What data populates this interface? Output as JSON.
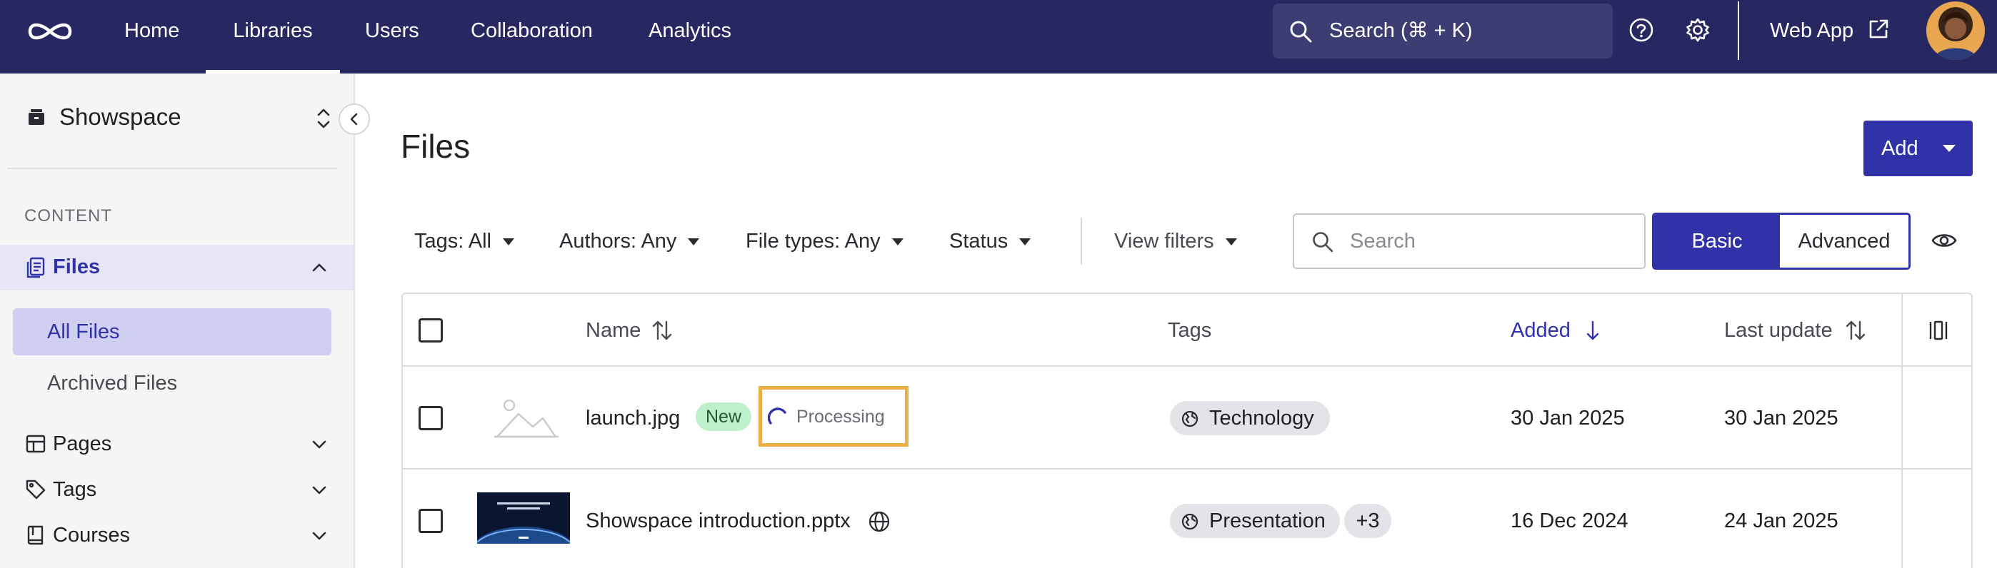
{
  "topbar": {
    "nav": [
      {
        "label": "Home",
        "active": false
      },
      {
        "label": "Libraries",
        "active": true
      },
      {
        "label": "Users",
        "active": false
      },
      {
        "label": "Collaboration",
        "active": false
      },
      {
        "label": "Analytics",
        "active": false
      }
    ],
    "search_label": "Search (⌘ + K)",
    "web_app_label": "Web App",
    "colors": {
      "bar": "#272862",
      "search_bg": "#3c3d73"
    }
  },
  "sidebar": {
    "workspace_name": "Showspace",
    "section_heading": "CONTENT",
    "files": {
      "label": "Files",
      "expanded": true,
      "children": [
        {
          "label": "All Files",
          "active": true
        },
        {
          "label": "Archived Files",
          "active": false
        }
      ]
    },
    "groups": [
      {
        "label": "Pages",
        "icon": "pages-icon"
      },
      {
        "label": "Tags",
        "icon": "tag-icon"
      },
      {
        "label": "Courses",
        "icon": "book-icon"
      }
    ]
  },
  "main": {
    "title": "Files",
    "add_label": "Add",
    "filters": [
      {
        "label": "Tags: All"
      },
      {
        "label": "Authors: Any"
      },
      {
        "label": "File types: Any"
      },
      {
        "label": "Status"
      },
      {
        "label": "View filters"
      }
    ],
    "search_placeholder": "Search",
    "view_toggle": {
      "basic": "Basic",
      "advanced": "Advanced",
      "selected": "Basic"
    },
    "accent_color": "#3232a8"
  },
  "table": {
    "columns": {
      "name": "Name",
      "tags": "Tags",
      "added": "Added",
      "last_update": "Last update"
    },
    "sorted_column": "Added",
    "rows": [
      {
        "name": "launch.jpg",
        "badge": "New",
        "status": "Processing",
        "tag": "Technology",
        "added": "30 Jan 2025",
        "last_update": "30 Jan 2025",
        "thumbnail": "image-placeholder-icon"
      },
      {
        "name": "Showspace introduction.pptx",
        "public": true,
        "tag": "Presentation",
        "extra_tags": "+3",
        "added": "16 Dec 2024",
        "last_update": "24 Jan 2025",
        "thumbnail": "presentation-thumbnail"
      }
    ]
  }
}
